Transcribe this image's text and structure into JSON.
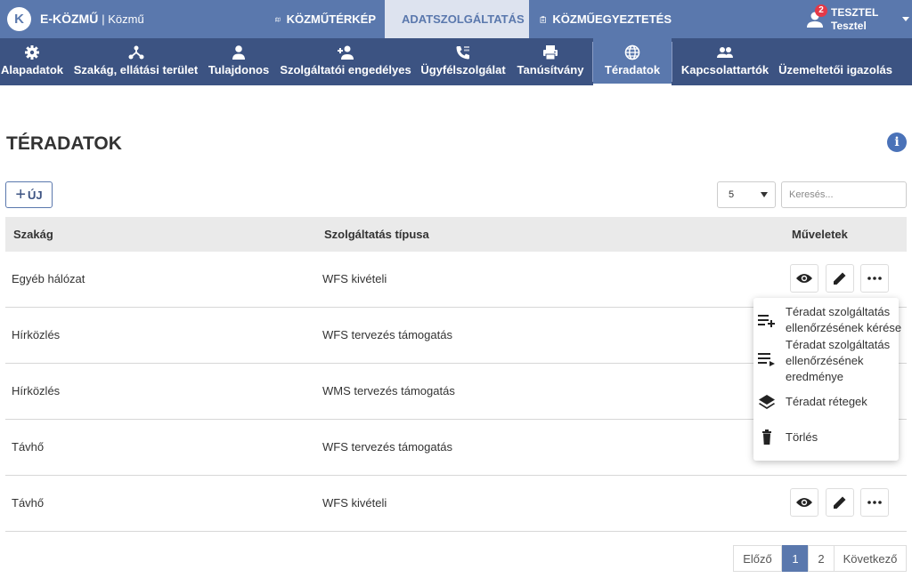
{
  "header": {
    "logo_letter": "K",
    "app_name": "E-KÖZMŰ",
    "app_sub": "| Közmű",
    "nav": [
      {
        "label": "KÖZMŰTÉRKÉP",
        "icon": "map-icon"
      },
      {
        "label": "ADATSZOLGÁLTATÁS",
        "icon": "id-card-icon",
        "active": true
      },
      {
        "label": "KÖZMŰEGYEZTETÉS",
        "icon": "clipboard-icon"
      }
    ],
    "user": {
      "badge": "2",
      "name": "TESZTEL",
      "sub": "Tesztel"
    }
  },
  "subnav": [
    {
      "label": "Alapadatok",
      "icon": "gear-icon"
    },
    {
      "label": "Szakág, ellátási terület",
      "icon": "network-icon"
    },
    {
      "label": "Tulajdonos",
      "icon": "person-icon"
    },
    {
      "label": "Szolgáltatói engedélyes",
      "icon": "person-add-icon"
    },
    {
      "label": "Ügyfélszolgálat",
      "icon": "phone-icon"
    },
    {
      "label": "Tanúsítvány",
      "icon": "printer-icon"
    },
    {
      "label": "Téradatok",
      "icon": "globe-icon",
      "active": true
    },
    {
      "label": "Kapcsolattartók",
      "icon": "people-icon"
    },
    {
      "label": "Üzemeltetői igazolás",
      "icon": "",
      "active": false
    }
  ],
  "page": {
    "title": "TÉRADATOK",
    "info": "i",
    "new_label": "ÚJ",
    "page_size": "5",
    "search_placeholder": "Keresés..."
  },
  "table": {
    "headers": [
      "Szakág",
      "Szolgáltatás típusa",
      "Műveletek"
    ],
    "rows": [
      [
        "Egyéb hálózat",
        "WFS kivételi"
      ],
      [
        "Hírközlés",
        "WFS tervezés támogatás"
      ],
      [
        "Hírközlés",
        "WMS tervezés támogatás"
      ],
      [
        "Távhő",
        "WFS tervezés támogatás"
      ],
      [
        "Távhő",
        "WFS kivételi"
      ]
    ]
  },
  "menu": {
    "items": [
      {
        "lines": [
          "Téradat szolgáltatás",
          "ellenőrzésének kérése"
        ],
        "icon": "playlist-add-icon"
      },
      {
        "lines": [
          "Téradat szolgáltatás",
          "ellenőrzésének",
          "eredménye"
        ],
        "icon": "playlist-play-icon"
      },
      {
        "lines": [
          "Téradat rétegek"
        ],
        "icon": "layers-icon"
      },
      {
        "lines": [
          "Törlés"
        ],
        "icon": "trash-icon"
      }
    ]
  },
  "pagination": {
    "prev": "Előző",
    "pages": [
      "1",
      "2"
    ],
    "current": "1",
    "next": "Következő"
  },
  "colors": {
    "primary": "#5a78ad",
    "primary_dark": "#3c5382",
    "badge": "#e53947"
  }
}
